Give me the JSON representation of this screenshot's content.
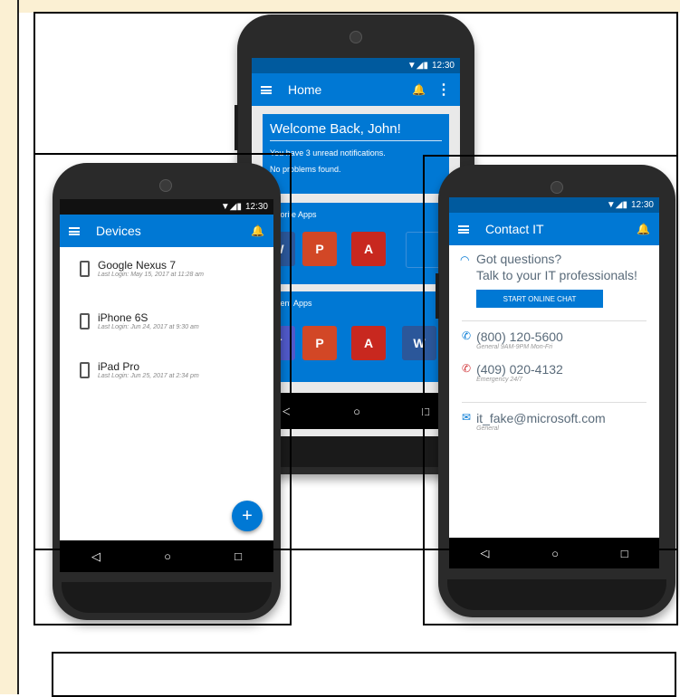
{
  "colors": {
    "accent": "#0078d4",
    "statusbar": "#005a9e",
    "background_strip": "#fbf0d3"
  },
  "status": {
    "time": "12:30"
  },
  "home": {
    "title": "Home",
    "welcome": "Welcome Back, John!",
    "notif_fragment": "ou have 3 unread notifications.",
    "problems_fragment": "o problems found.",
    "notif_prefix": "Y",
    "problems_prefix": "N",
    "favorite_label": "avorite Apps",
    "recent_label": "ecent Apps",
    "favorite_apps": [
      "W",
      "P",
      "A"
    ],
    "recent_apps": [
      "T",
      "P",
      "A",
      "W"
    ]
  },
  "devices": {
    "title": "Devices",
    "items": [
      {
        "name": "Google Nexus 7",
        "last": "Last Login: May 15, 2017 at 11:28 am"
      },
      {
        "name": "iPhone 6S",
        "last": "Last Login: Jun 24, 2017 at 9:30 am"
      },
      {
        "name": "iPad Pro",
        "last": "Last Login: Jun 25, 2017 at 2:34 pm"
      }
    ],
    "fab": "+"
  },
  "contact": {
    "title": "Contact IT",
    "q1": "Got questions?",
    "q2": "Talk to your IT professionals!",
    "chat_button": "START ONLINE CHAT",
    "phone1": "(800) 120-5600",
    "phone1_sub": "General 9AM-9PM Mon-Fri",
    "phone2": "(409) 020-4132",
    "phone2_sub": "Emergency 24/7",
    "email": "it_fake@microsoft.com",
    "email_sub": "General"
  },
  "nav": {
    "back": "◁",
    "home": "○",
    "recent": "□"
  }
}
